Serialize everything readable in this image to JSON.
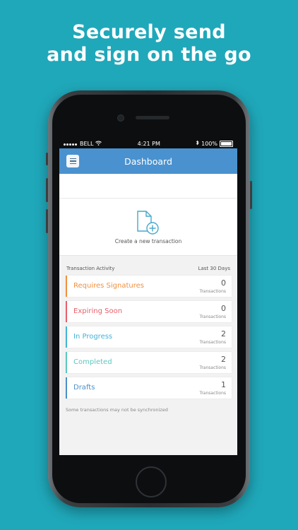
{
  "headline": {
    "line1": "Securely send",
    "line2": "and sign on the go"
  },
  "status_bar": {
    "carrier": "BELL",
    "time": "4:21 PM",
    "battery": "100%"
  },
  "navbar": {
    "title": "Dashboard"
  },
  "create": {
    "label": "Create a new transaction"
  },
  "activity": {
    "title": "Transaction Activity",
    "period": "Last 30 Days",
    "items": [
      {
        "label": "Requires Signatures",
        "count": "0",
        "sub": "Transactions",
        "color": "#f0913f"
      },
      {
        "label": "Expiring Soon",
        "count": "0",
        "sub": "Transactions",
        "color": "#e8606b"
      },
      {
        "label": "In Progress",
        "count": "2",
        "sub": "Transactions",
        "color": "#42b4d8"
      },
      {
        "label": "Completed",
        "count": "2",
        "sub": "Transactions",
        "color": "#5cc7bf"
      },
      {
        "label": "Drafts",
        "count": "1",
        "sub": "Transactions",
        "color": "#4a8fca"
      }
    ]
  },
  "footnote": "Some transactions may not be synchronized",
  "colors": {
    "background": "#1fa8ba",
    "navbar": "#4a92cf"
  }
}
